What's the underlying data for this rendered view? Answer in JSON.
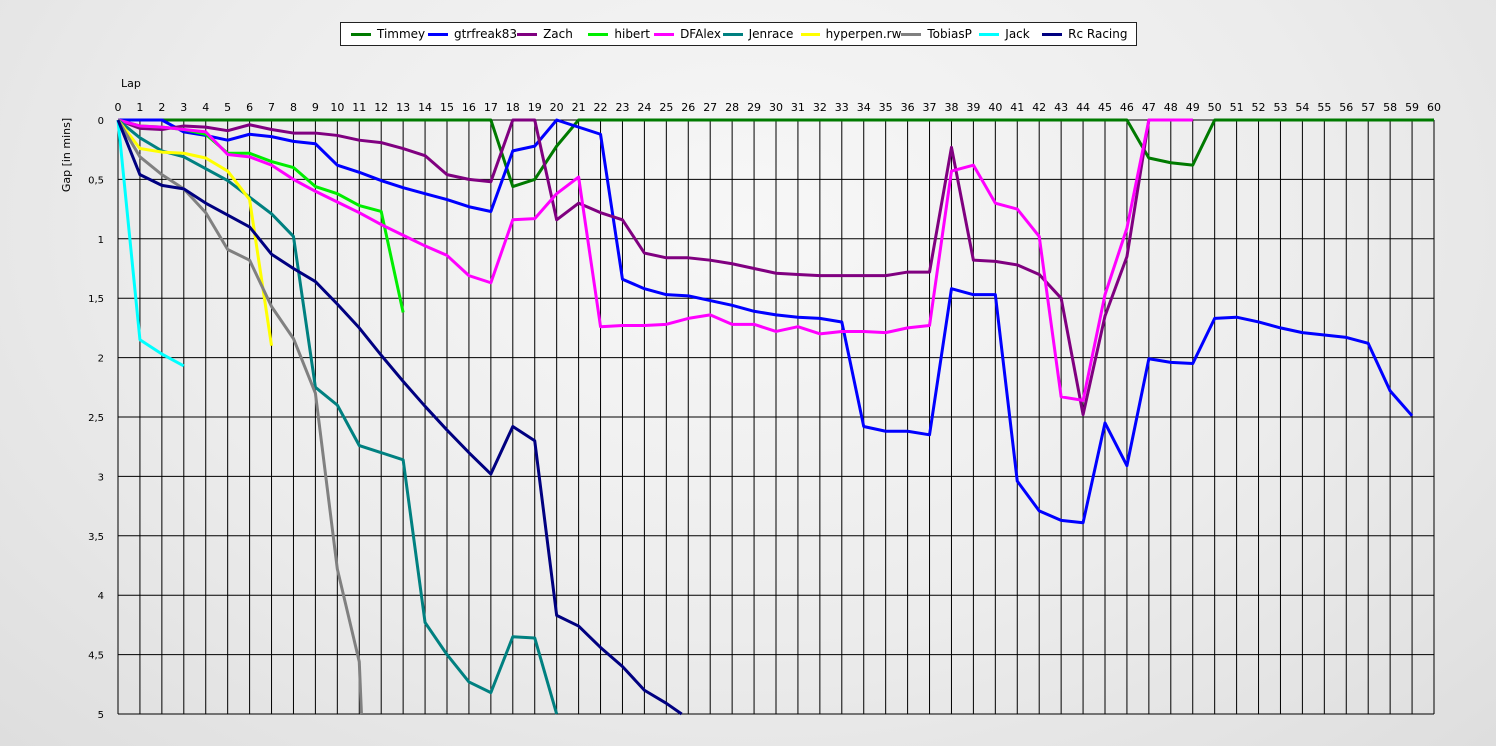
{
  "chart_data": {
    "type": "line",
    "xlabel": "Lap",
    "ylabel": "Gap [in mins]",
    "xlim": [
      0,
      60
    ],
    "ylim": [
      0,
      5
    ],
    "y_inverted": true,
    "grid": true,
    "legend_position": "top-center",
    "x_ticks": [
      "0",
      "1",
      "2",
      "3",
      "4",
      "5",
      "6",
      "7",
      "8",
      "9",
      "10",
      "11",
      "12",
      "13",
      "14",
      "15",
      "16",
      "17",
      "18",
      "19",
      "20",
      "21",
      "22",
      "23",
      "24",
      "25",
      "26",
      "27",
      "28",
      "29",
      "30",
      "31",
      "32",
      "33",
      "34",
      "35",
      "36",
      "37",
      "38",
      "39",
      "40",
      "41",
      "42",
      "43",
      "44",
      "45",
      "46",
      "47",
      "48",
      "49",
      "50",
      "51",
      "52",
      "53",
      "54",
      "55",
      "56",
      "57",
      "58",
      "59",
      "60"
    ],
    "y_ticks": [
      "0",
      "0,5",
      "1",
      "1,5",
      "2",
      "2,5",
      "3",
      "3,5",
      "4",
      "4,5",
      "5"
    ],
    "series": [
      {
        "name": "Timmey",
        "color": "#007a00",
        "points": [
          [
            0,
            0
          ],
          [
            1,
            0
          ],
          [
            2,
            0
          ],
          [
            3,
            0
          ],
          [
            4,
            0
          ],
          [
            5,
            0
          ],
          [
            6,
            0
          ],
          [
            7,
            0
          ],
          [
            8,
            0
          ],
          [
            9,
            0
          ],
          [
            10,
            0
          ],
          [
            11,
            0
          ],
          [
            12,
            0
          ],
          [
            13,
            0
          ],
          [
            14,
            0
          ],
          [
            15,
            0
          ],
          [
            16,
            0
          ],
          [
            17,
            0
          ],
          [
            18,
            0.56
          ],
          [
            19,
            0.5
          ],
          [
            20,
            0.22
          ],
          [
            21,
            0
          ],
          [
            22,
            0
          ],
          [
            23,
            0
          ],
          [
            24,
            0
          ],
          [
            25,
            0
          ],
          [
            26,
            0
          ],
          [
            27,
            0
          ],
          [
            28,
            0
          ],
          [
            29,
            0
          ],
          [
            30,
            0
          ],
          [
            31,
            0
          ],
          [
            32,
            0
          ],
          [
            33,
            0
          ],
          [
            34,
            0
          ],
          [
            35,
            0
          ],
          [
            36,
            0
          ],
          [
            37,
            0
          ],
          [
            38,
            0
          ],
          [
            39,
            0
          ],
          [
            40,
            0
          ],
          [
            41,
            0
          ],
          [
            42,
            0
          ],
          [
            43,
            0
          ],
          [
            44,
            0
          ],
          [
            45,
            0
          ],
          [
            46,
            0
          ],
          [
            47,
            0.32
          ],
          [
            48,
            0.36
          ],
          [
            49,
            0.38
          ],
          [
            50,
            0
          ],
          [
            51,
            0
          ],
          [
            52,
            0
          ],
          [
            53,
            0
          ],
          [
            54,
            0
          ],
          [
            55,
            0
          ],
          [
            56,
            0
          ],
          [
            57,
            0
          ],
          [
            58,
            0
          ],
          [
            59,
            0
          ],
          [
            60,
            0
          ]
        ]
      },
      {
        "name": "gtrfreak83",
        "color": "#0000ff",
        "points": [
          [
            0,
            0
          ],
          [
            1,
            0
          ],
          [
            2,
            0
          ],
          [
            3,
            0.1
          ],
          [
            4,
            0.13
          ],
          [
            5,
            0.17
          ],
          [
            6,
            0.12
          ],
          [
            7,
            0.14
          ],
          [
            8,
            0.18
          ],
          [
            9,
            0.2
          ],
          [
            10,
            0.38
          ],
          [
            11,
            0.44
          ],
          [
            12,
            0.51
          ],
          [
            13,
            0.57
          ],
          [
            14,
            0.62
          ],
          [
            15,
            0.67
          ],
          [
            16,
            0.73
          ],
          [
            17,
            0.77
          ],
          [
            18,
            0.26
          ],
          [
            19,
            0.22
          ],
          [
            20,
            0
          ],
          [
            21,
            0.06
          ],
          [
            22,
            0.12
          ],
          [
            23,
            1.34
          ],
          [
            24,
            1.42
          ],
          [
            25,
            1.47
          ],
          [
            26,
            1.48
          ],
          [
            27,
            1.52
          ],
          [
            28,
            1.56
          ],
          [
            29,
            1.61
          ],
          [
            30,
            1.64
          ],
          [
            31,
            1.66
          ],
          [
            32,
            1.67
          ],
          [
            33,
            1.7
          ],
          [
            34,
            2.58
          ],
          [
            35,
            2.62
          ],
          [
            36,
            2.62
          ],
          [
            37,
            2.65
          ],
          [
            38,
            1.42
          ],
          [
            39,
            1.47
          ],
          [
            40,
            1.47
          ],
          [
            41,
            3.04
          ],
          [
            42,
            3.29
          ],
          [
            43,
            3.37
          ],
          [
            44,
            3.39
          ],
          [
            45,
            2.55
          ],
          [
            46,
            2.91
          ],
          [
            47,
            2.01
          ],
          [
            48,
            2.04
          ],
          [
            49,
            2.05
          ],
          [
            50,
            1.67
          ],
          [
            51,
            1.66
          ],
          [
            52,
            1.7
          ],
          [
            53,
            1.75
          ],
          [
            54,
            1.79
          ],
          [
            55,
            1.81
          ],
          [
            56,
            1.83
          ],
          [
            57,
            1.88
          ],
          [
            58,
            2.28
          ],
          [
            59,
            2.49
          ]
        ]
      },
      {
        "name": "Zach",
        "color": "#800080",
        "points": [
          [
            0,
            0
          ],
          [
            1,
            0.07
          ],
          [
            2,
            0.08
          ],
          [
            3,
            0.05
          ],
          [
            4,
            0.06
          ],
          [
            5,
            0.09
          ],
          [
            6,
            0.04
          ],
          [
            7,
            0.08
          ],
          [
            8,
            0.11
          ],
          [
            9,
            0.11
          ],
          [
            10,
            0.13
          ],
          [
            11,
            0.17
          ],
          [
            12,
            0.19
          ],
          [
            13,
            0.24
          ],
          [
            14,
            0.3
          ],
          [
            15,
            0.46
          ],
          [
            16,
            0.5
          ],
          [
            17,
            0.52
          ],
          [
            18,
            0
          ],
          [
            19,
            0
          ],
          [
            20,
            0.84
          ],
          [
            21,
            0.7
          ],
          [
            22,
            0.78
          ],
          [
            23,
            0.84
          ],
          [
            24,
            1.12
          ],
          [
            25,
            1.16
          ],
          [
            26,
            1.16
          ],
          [
            27,
            1.18
          ],
          [
            28,
            1.21
          ],
          [
            29,
            1.25
          ],
          [
            30,
            1.29
          ],
          [
            31,
            1.3
          ],
          [
            32,
            1.31
          ],
          [
            33,
            1.31
          ],
          [
            34,
            1.31
          ],
          [
            35,
            1.31
          ],
          [
            36,
            1.28
          ],
          [
            37,
            1.28
          ],
          [
            38,
            0.23
          ],
          [
            39,
            1.18
          ],
          [
            40,
            1.19
          ],
          [
            41,
            1.22
          ],
          [
            42,
            1.3
          ],
          [
            43,
            1.5
          ],
          [
            44,
            2.48
          ],
          [
            45,
            1.65
          ],
          [
            46,
            1.15
          ],
          [
            47,
            0
          ],
          [
            48,
            0
          ],
          [
            49,
            0
          ]
        ]
      },
      {
        "name": "hibert",
        "color": "#00ee00",
        "points": [
          [
            0,
            0
          ],
          [
            1,
            0.05
          ],
          [
            2,
            0.06
          ],
          [
            3,
            0.08
          ],
          [
            4,
            0.12
          ],
          [
            5,
            0.28
          ],
          [
            6,
            0.28
          ],
          [
            7,
            0.35
          ],
          [
            8,
            0.4
          ],
          [
            9,
            0.56
          ],
          [
            10,
            0.62
          ],
          [
            11,
            0.72
          ],
          [
            12,
            0.77
          ],
          [
            13,
            1.62
          ]
        ]
      },
      {
        "name": "DFAlex",
        "color": "#ff00ff",
        "points": [
          [
            0,
            0
          ],
          [
            1,
            0.05
          ],
          [
            2,
            0.06
          ],
          [
            3,
            0.08
          ],
          [
            4,
            0.1
          ],
          [
            5,
            0.29
          ],
          [
            6,
            0.31
          ],
          [
            7,
            0.38
          ],
          [
            8,
            0.5
          ],
          [
            9,
            0.6
          ],
          [
            10,
            0.69
          ],
          [
            11,
            0.78
          ],
          [
            12,
            0.88
          ],
          [
            13,
            0.97
          ],
          [
            14,
            1.06
          ],
          [
            15,
            1.14
          ],
          [
            16,
            1.31
          ],
          [
            17,
            1.37
          ],
          [
            18,
            0.84
          ],
          [
            19,
            0.83
          ],
          [
            20,
            0.62
          ],
          [
            21,
            0.48
          ],
          [
            22,
            1.74
          ],
          [
            23,
            1.73
          ],
          [
            24,
            1.73
          ],
          [
            25,
            1.72
          ],
          [
            26,
            1.67
          ],
          [
            27,
            1.64
          ],
          [
            28,
            1.72
          ],
          [
            29,
            1.72
          ],
          [
            30,
            1.78
          ],
          [
            31,
            1.74
          ],
          [
            32,
            1.8
          ],
          [
            33,
            1.78
          ],
          [
            34,
            1.78
          ],
          [
            35,
            1.79
          ],
          [
            36,
            1.75
          ],
          [
            37,
            1.73
          ],
          [
            38,
            0.43
          ],
          [
            39,
            0.38
          ],
          [
            40,
            0.7
          ],
          [
            41,
            0.75
          ],
          [
            42,
            0.98
          ],
          [
            43,
            2.33
          ],
          [
            44,
            2.36
          ],
          [
            45,
            1.47
          ],
          [
            46,
            0.91
          ],
          [
            47,
            0
          ],
          [
            48,
            0
          ],
          [
            49,
            0
          ]
        ]
      },
      {
        "name": "Jenrace",
        "color": "#008080",
        "points": [
          [
            0,
            0
          ],
          [
            1,
            0.15
          ],
          [
            2,
            0.26
          ],
          [
            3,
            0.31
          ],
          [
            4,
            0.41
          ],
          [
            5,
            0.51
          ],
          [
            6,
            0.65
          ],
          [
            7,
            0.79
          ],
          [
            8,
            0.98
          ],
          [
            9,
            2.25
          ],
          [
            10,
            2.4
          ],
          [
            11,
            2.74
          ],
          [
            12,
            2.8
          ],
          [
            13,
            2.86
          ],
          [
            14,
            4.23
          ],
          [
            15,
            4.5
          ],
          [
            16,
            4.73
          ],
          [
            17,
            4.82
          ],
          [
            18,
            4.35
          ],
          [
            19,
            4.36
          ],
          [
            20,
            5.0
          ]
        ]
      },
      {
        "name": "hyperpen.rw",
        "color": "#ffff00",
        "points": [
          [
            0,
            0
          ],
          [
            1,
            0.24
          ],
          [
            2,
            0.27
          ],
          [
            3,
            0.28
          ],
          [
            4,
            0.32
          ],
          [
            5,
            0.43
          ],
          [
            6,
            0.67
          ],
          [
            7,
            1.9
          ]
        ]
      },
      {
        "name": "TobiasP",
        "color": "#808080",
        "points": [
          [
            0,
            0
          ],
          [
            1,
            0.31
          ],
          [
            2,
            0.46
          ],
          [
            3,
            0.58
          ],
          [
            4,
            0.78
          ],
          [
            5,
            1.09
          ],
          [
            6,
            1.18
          ],
          [
            7,
            1.57
          ],
          [
            8,
            1.84
          ],
          [
            9,
            2.3
          ],
          [
            10,
            3.78
          ],
          [
            11,
            4.56
          ],
          [
            11.1,
            5.0
          ]
        ]
      },
      {
        "name": "Jack",
        "color": "#00ffff",
        "points": [
          [
            0,
            0
          ],
          [
            1,
            1.85
          ],
          [
            2,
            1.97
          ],
          [
            3,
            2.07
          ]
        ]
      },
      {
        "name": "Rc Racing",
        "color": "#000080",
        "points": [
          [
            0,
            0
          ],
          [
            1,
            0.46
          ],
          [
            2,
            0.55
          ],
          [
            3,
            0.58
          ],
          [
            4,
            0.7
          ],
          [
            5,
            0.8
          ],
          [
            6,
            0.9
          ],
          [
            7,
            1.13
          ],
          [
            8,
            1.25
          ],
          [
            9,
            1.36
          ],
          [
            10,
            1.55
          ],
          [
            11,
            1.75
          ],
          [
            12,
            1.98
          ],
          [
            13,
            2.2
          ],
          [
            14,
            2.41
          ],
          [
            15,
            2.61
          ],
          [
            16,
            2.8
          ],
          [
            17,
            2.98
          ],
          [
            18,
            2.58
          ],
          [
            19,
            2.7
          ],
          [
            20,
            4.17
          ],
          [
            21,
            4.26
          ],
          [
            22,
            4.44
          ],
          [
            23,
            4.6
          ],
          [
            24,
            4.8
          ],
          [
            25,
            4.91
          ],
          [
            25.7,
            5.0
          ]
        ]
      }
    ]
  }
}
